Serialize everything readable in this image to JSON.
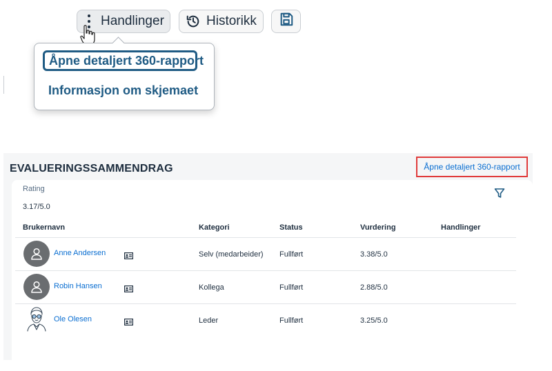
{
  "toolbar": {
    "actions_label": "Handlinger",
    "history_label": "Historikk",
    "save_icon": "save-icon"
  },
  "popover": {
    "items": [
      {
        "label": "Åpne detaljert 360-rapport"
      },
      {
        "label": "Informasjon om skjemaet"
      }
    ]
  },
  "summary": {
    "title": "EVALUERINGSSAMMENDRAG",
    "report_link": "Åpne detaljert 360-rapport",
    "rating_label": "Rating",
    "rating_value": "3.17/5.0",
    "columns": [
      "Brukernavn",
      "Kategori",
      "Status",
      "Vurdering",
      "Handlinger"
    ],
    "rows": [
      {
        "name": "Anne Andersen",
        "category": "Selv (medarbeider)",
        "status": "Fullført",
        "rating": "3.38/5.0"
      },
      {
        "name": "Robin Hansen",
        "category": "Kollega",
        "status": "Fullført",
        "rating": "2.88/5.0"
      },
      {
        "name": "Ole Olesen",
        "category": "Leder",
        "status": "Fullført",
        "rating": "3.25/5.0"
      }
    ]
  },
  "colors": {
    "link": "#0a6ed1",
    "menu_text": "#1f5b84",
    "highlight_border": "#e03a3a",
    "avatar_bg": "#6a6d70"
  }
}
